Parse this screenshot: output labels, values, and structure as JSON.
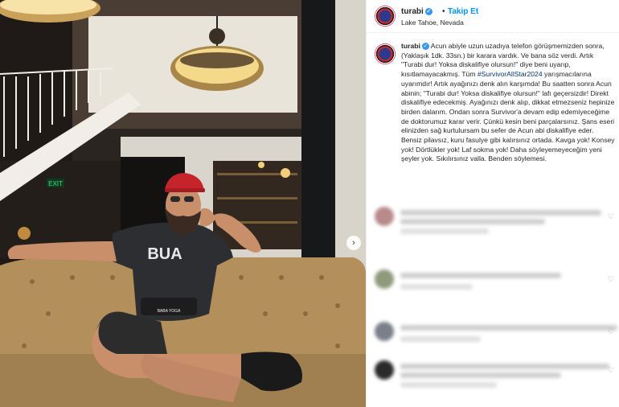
{
  "account": {
    "username": "turabi",
    "verified_mark": "✓",
    "separator": "•",
    "follow_label": "Takip Et",
    "location": "Lake Tahoe, Nevada"
  },
  "caption": {
    "username": "turabi",
    "verified_mark": "✓",
    "text_before_hashtag": " Acun abiyle uzun uzadıya telefon görüşmemizden sonra, (Yaklaşık 1dk. 33sn.) bir karara vardık. Ve bana söz verdi. Artık \"Turabi dur! Yoksa diskalifiye olursun!\" diye beni uyarıp, kısıtlamayacakmış. Tüm ",
    "hashtag": "#SurvivorAllStar2024",
    "text_after_hashtag": " yarışmacılarına uyarımdır! Artık ayağınızı denk alın karşımda! Bu saatten sonra Acun abinin; \"Turabi dur! Yoksa diskalifiye olursun!\" lafı geçersizdir! Direkt diskalifiye edecekmiş. Ayağınızı denk alıp, dikkat etmezseniz hepinize birden dalarım. Ondan sonra Survivor'a devam edip edemiyeceğime de doktorumuz karar verir. Çünkü kesin beni parçalarsınız. Şans eseri elinizden sağ kurtulursam bu sefer de Acun abi diskalifiye eder. Bensiz pilavsız, kuru fasulye gibi kalırsınız ortada. Kavga yok! Konsey yok! Dörtlükler yok! Laf sokma yok! Daha söyleyemeyeceğim yeni şeyler yok. Sıkılırsınız valla. Benden söylemesi."
  },
  "photo": {
    "shirt_text": "BUA",
    "shorts_text": "BABA YOGA",
    "exit_sign": "EXIT"
  },
  "icons": {
    "next": "chevron-right-icon",
    "like": "heart-icon"
  },
  "colors": {
    "accent": "#0095f6",
    "hashtag": "#00376b",
    "verified": "#3897f0",
    "text": "#262626"
  }
}
